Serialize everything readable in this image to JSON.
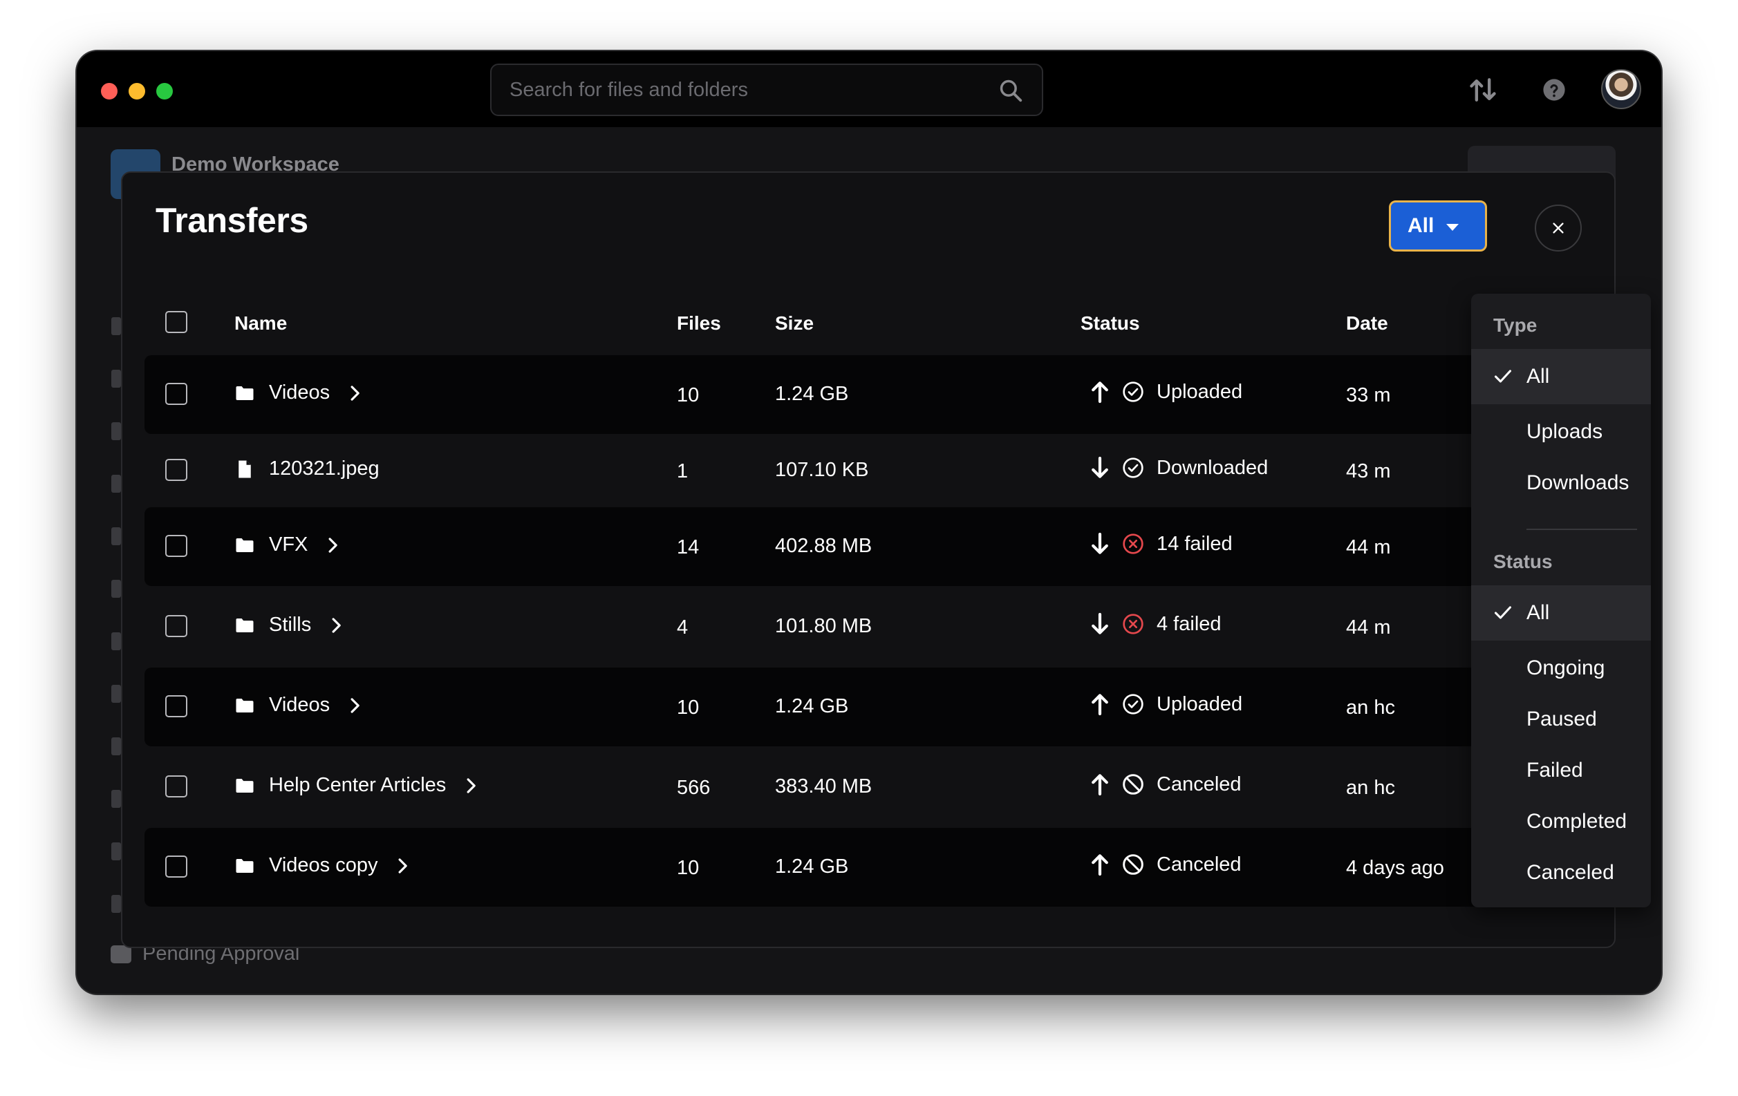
{
  "search": {
    "placeholder": "Search for files and folders"
  },
  "background": {
    "workspace_name": "Demo Workspace",
    "pending_label": "Pending Approval"
  },
  "modal": {
    "title": "Transfers",
    "filter_label": "All",
    "close_symbol": "×"
  },
  "table": {
    "headers": {
      "name": "Name",
      "files": "Files",
      "size": "Size",
      "status": "Status",
      "date": "Date"
    },
    "rows": [
      {
        "type": "folder",
        "name": "Videos",
        "files": "10",
        "size": "1.24 GB",
        "direction": "up",
        "status_kind": "ok",
        "status": "Uploaded",
        "date": "33 m"
      },
      {
        "type": "file",
        "name": "120321.jpeg",
        "files": "1",
        "size": "107.10 KB",
        "direction": "down",
        "status_kind": "ok",
        "status": "Downloaded",
        "date": "43 m"
      },
      {
        "type": "folder",
        "name": "VFX",
        "files": "14",
        "size": "402.88 MB",
        "direction": "down",
        "status_kind": "failed",
        "status": "14 failed",
        "date": "44 m"
      },
      {
        "type": "folder",
        "name": "Stills",
        "files": "4",
        "size": "101.80 MB",
        "direction": "down",
        "status_kind": "failed",
        "status": "4 failed",
        "date": "44 m"
      },
      {
        "type": "folder",
        "name": "Videos",
        "files": "10",
        "size": "1.24 GB",
        "direction": "up",
        "status_kind": "ok",
        "status": "Uploaded",
        "date": "an hc"
      },
      {
        "type": "folder",
        "name": "Help Center Articles",
        "files": "566",
        "size": "383.40 MB",
        "direction": "up",
        "status_kind": "canceled",
        "status": "Canceled",
        "date": "an hc"
      },
      {
        "type": "folder",
        "name": "Videos copy",
        "files": "10",
        "size": "1.24 GB",
        "direction": "up",
        "status_kind": "canceled",
        "status": "Canceled",
        "date": "4 days ago"
      }
    ]
  },
  "dropdown": {
    "type_heading": "Type",
    "type_options": [
      "All",
      "Uploads",
      "Downloads"
    ],
    "type_selected": "All",
    "status_heading": "Status",
    "status_options": [
      "All",
      "Ongoing",
      "Paused",
      "Failed",
      "Completed",
      "Canceled"
    ],
    "status_selected": "All"
  },
  "colors": {
    "accent": "#1b5fd6",
    "focus_ring": "#e9b34a",
    "failed": "#e5484d"
  }
}
